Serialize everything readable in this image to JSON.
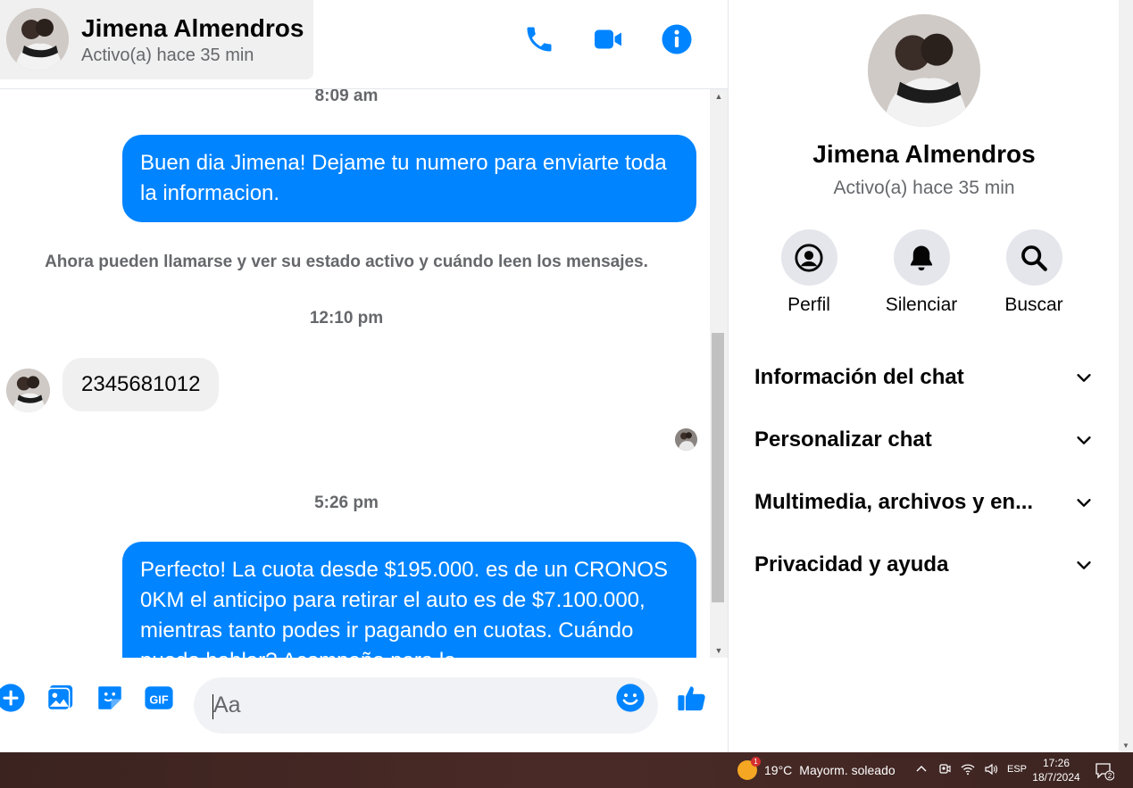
{
  "contact": {
    "name": "Jimena Almendros",
    "status": "Activo(a) hace 35 min"
  },
  "messages": {
    "time_1": "8:09 am",
    "out_1": "Buen dia Jimena! Dejame tu numero para enviarte toda la informacion.",
    "system_note": "Ahora pueden llamarse y ver su estado activo y cuándo leen los mensajes.",
    "time_2": "12:10 pm",
    "in_1": "2345681012",
    "time_3": "5:26 pm",
    "out_2": "Perfecto! La cuota desde $195.000. es de un CRONOS 0KM el anticipo para retirar el auto es de $7.100.000, mientras tanto podes ir pagando en cuotas. Cuándo puedo hablar? Acompaño para la"
  },
  "composer": {
    "placeholder": "Aa"
  },
  "info_panel": {
    "name": "Jimena Almendros",
    "status": "Activo(a) hace 35 min",
    "actions": [
      {
        "label": "Perfil",
        "icon": "profile-icon"
      },
      {
        "label": "Silenciar",
        "icon": "bell-icon"
      },
      {
        "label": "Buscar",
        "icon": "search-icon"
      }
    ],
    "sections": [
      {
        "label": "Información del chat"
      },
      {
        "label": "Personalizar chat"
      },
      {
        "label": "Multimedia, archivos y en..."
      },
      {
        "label": "Privacidad y ayuda"
      }
    ]
  },
  "taskbar": {
    "temperature": "19°C",
    "weather": "Mayorm. soleado",
    "weather_badge": "1",
    "language": "ESP",
    "time": "17:26",
    "date": "18/7/2024",
    "notification_count": "2"
  },
  "colors": {
    "accent": "#0084ff",
    "bubble_in": "#f0f0f0",
    "secondary_text": "#65676b"
  }
}
